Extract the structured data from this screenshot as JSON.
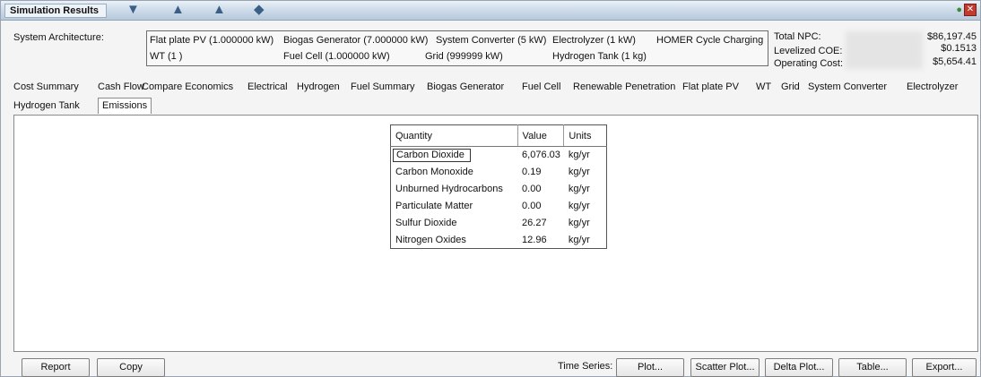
{
  "window": {
    "title": "Simulation Results"
  },
  "architecture": {
    "label": "System Architecture:",
    "items_row1": [
      "Flat plate PV (1.000000 kW)",
      "Biogas Generator (7.000000 kW)",
      "System Converter (5 kW)",
      "Electrolyzer (1 kW)",
      "HOMER Cycle Charging"
    ],
    "items_row2": [
      "WT  (1 )",
      "Fuel Cell (1.000000 kW)",
      "Grid (999999 kW)",
      "Hydrogen Tank (1 kg)"
    ]
  },
  "costs": {
    "npc_label": "Total NPC:",
    "npc_value": "$86,197.45",
    "coe_label": "Levelized COE:",
    "coe_value": "$0.1513",
    "op_label": "Operating Cost:",
    "op_value": "$5,654.41"
  },
  "tabs": {
    "row1": [
      "Cost Summary",
      "Cash Flow",
      "Compare Economics",
      "Electrical",
      "Hydrogen",
      "Fuel Summary",
      "Biogas Generator",
      "Fuel Cell",
      "Renewable Penetration",
      "Flat plate PV",
      "WT",
      "Grid",
      "System Converter",
      "Electrolyzer"
    ],
    "row2": [
      "Hydrogen Tank",
      "Emissions"
    ],
    "active": "Emissions"
  },
  "emissions": {
    "headers": [
      "Quantity",
      "Value",
      "Units"
    ],
    "rows": [
      [
        "Carbon Dioxide",
        "6,076.03",
        "kg/yr"
      ],
      [
        "Carbon Monoxide",
        "0.19",
        "kg/yr"
      ],
      [
        "Unburned Hydrocarbons",
        "0.00",
        "kg/yr"
      ],
      [
        "Particulate Matter",
        "0.00",
        "kg/yr"
      ],
      [
        "Sulfur Dioxide",
        "26.27",
        "kg/yr"
      ],
      [
        "Nitrogen Oxides",
        "12.96",
        "kg/yr"
      ]
    ]
  },
  "buttons": {
    "report": "Report",
    "copy": "Copy",
    "time_series_label": "Time Series:",
    "plot": "Plot...",
    "scatter_plot": "Scatter Plot...",
    "delta_plot": "Delta Plot...",
    "table": "Table...",
    "export": "Export..."
  },
  "icons": {
    "close": "close-icon",
    "toolbar": [
      "filter-icon",
      "chart-icon",
      "chart-icon",
      "plug-icon"
    ]
  }
}
